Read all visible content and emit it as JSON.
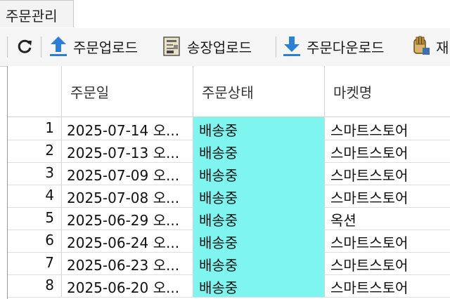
{
  "tabs": [
    {
      "label": "주문관리"
    }
  ],
  "toolbar": {
    "refresh_label": "",
    "order_upload_label": "주문업로드",
    "invoice_upload_label": "송장업로드",
    "order_download_label": "주문다운로드",
    "partial_label": "재"
  },
  "table": {
    "columns": [
      "",
      "주문일",
      "주문상태",
      "마켓명"
    ],
    "rows": [
      {
        "no": "1",
        "date": "2025-07-14 오...",
        "status": "배송중",
        "market": "스마트스토어"
      },
      {
        "no": "2",
        "date": "2025-07-13 오...",
        "status": "배송중",
        "market": "스마트스토어"
      },
      {
        "no": "3",
        "date": "2025-07-09 오...",
        "status": "배송중",
        "market": "스마트스토어"
      },
      {
        "no": "4",
        "date": "2025-07-08 오...",
        "status": "배송중",
        "market": "스마트스토어"
      },
      {
        "no": "5",
        "date": "2025-06-29 오...",
        "status": "배송중",
        "market": "옥션"
      },
      {
        "no": "6",
        "date": "2025-06-24 오...",
        "status": "배송중",
        "market": "스마트스토어"
      },
      {
        "no": "7",
        "date": "2025-06-23 오...",
        "status": "배송중",
        "market": "스마트스토어"
      },
      {
        "no": "8",
        "date": "2025-06-20 오...",
        "status": "배송중",
        "market": "스마트스토어"
      }
    ]
  },
  "colors": {
    "status_highlight": "#7ff5f0",
    "icon_blue": "#2b7fd6"
  }
}
